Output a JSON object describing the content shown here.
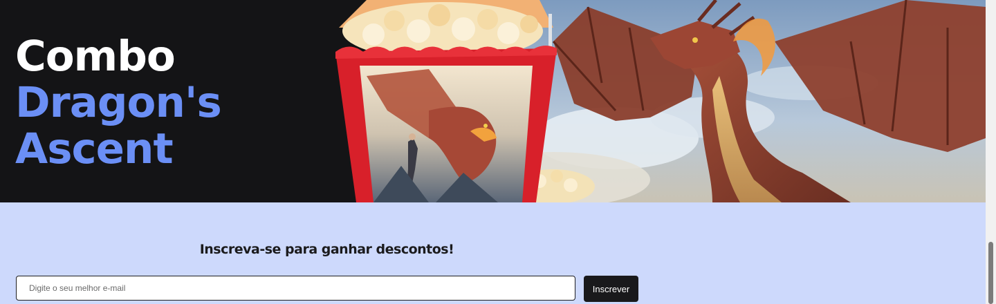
{
  "hero": {
    "title_line1": "Combo",
    "title_line2": "Dragon's",
    "title_line3": "Ascent",
    "image_icon": "dragon-popcorn-banner"
  },
  "signup": {
    "heading": "Inscreva-se para ganhar descontos!",
    "email_placeholder": "Digite o seu melhor e-mail",
    "email_value": "",
    "button_label": "Inscrever"
  },
  "colors": {
    "hero_bg": "#141416",
    "accent_blue": "#6b8ff5",
    "signup_bg": "#cdd9fc",
    "button_bg": "#19191b"
  }
}
